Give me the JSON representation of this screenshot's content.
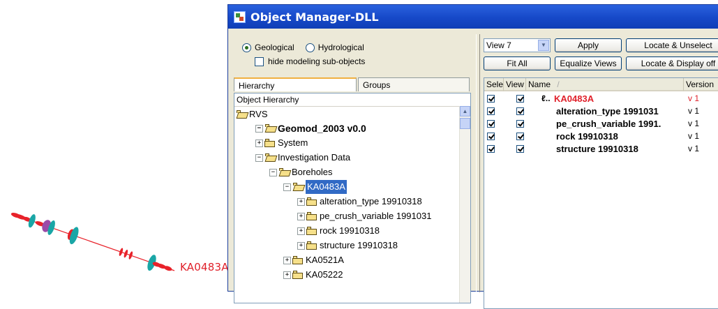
{
  "scene": {
    "borehole_label": "KA0483A"
  },
  "window": {
    "title": "Object Manager-DLL"
  },
  "left_panel": {
    "radio_geological": "Geological",
    "radio_hydrological": "Hydrological",
    "selected_radio": "Geological",
    "hide_label": "hide modeling sub-objects",
    "tabs": [
      "Hierarchy",
      "Groups"
    ],
    "active_tab": "Hierarchy",
    "tree_header": "Object Hierarchy",
    "tree": [
      {
        "label": "RVS"
      },
      {
        "label": "Geomod_2003  v0.0"
      },
      {
        "label": "System"
      },
      {
        "label": "Investigation Data"
      },
      {
        "label": "Boreholes"
      },
      {
        "label": "KA0483A"
      },
      {
        "label": "alteration_type 19910318"
      },
      {
        "label": "pe_crush_variable 1991031"
      },
      {
        "label": "rock 19910318"
      },
      {
        "label": "structure 19910318"
      },
      {
        "label": "KA0521A"
      },
      {
        "label": "KA05222"
      }
    ]
  },
  "right_panel": {
    "view_select": "View 7",
    "buttons": {
      "apply": "Apply",
      "locate_unselect": "Locate & Unselect",
      "fit_all": "Fit All",
      "equalize": "Equalize Views",
      "locate_display_off": "Locate & Display off"
    },
    "columns": [
      "Selec",
      "View",
      "Name",
      "Version"
    ],
    "sort_indicator": "/",
    "rows": [
      {
        "name": "KA0483A",
        "version": "v 1",
        "color": "#e0202a"
      },
      {
        "name": "alteration_type 1991031",
        "version": "v 1"
      },
      {
        "name": "pe_crush_variable 1991.",
        "version": "v 1"
      },
      {
        "name": "rock 19910318",
        "version": "v 1"
      },
      {
        "name": "structure 19910318",
        "version": "v 1"
      }
    ]
  }
}
